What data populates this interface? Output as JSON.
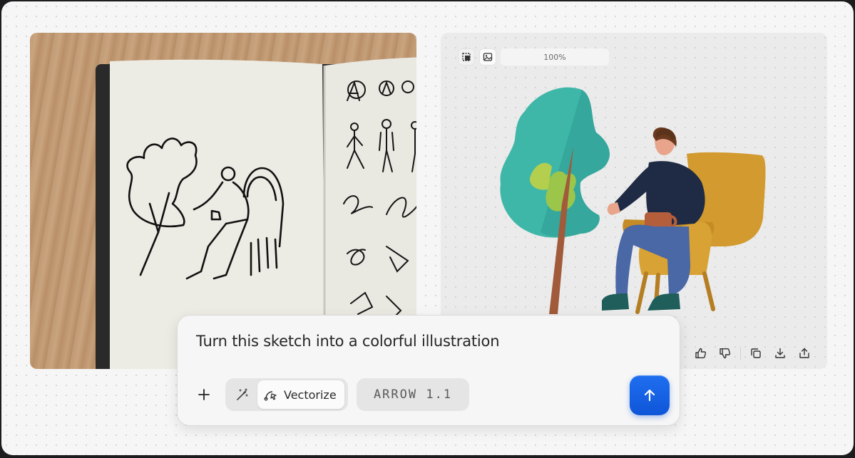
{
  "canvas": {
    "zoom_label": "100%",
    "toolbar": [
      {
        "icon": "crop-frame-icon"
      },
      {
        "icon": "image-icon"
      }
    ]
  },
  "input_image": {
    "description_icon": "sketchbook-photo"
  },
  "output_actions": [
    {
      "icon": "thumbs-up-icon"
    },
    {
      "icon": "thumbs-down-icon"
    },
    {
      "icon": "copy-icon"
    },
    {
      "icon": "download-icon"
    },
    {
      "icon": "share-icon"
    }
  ],
  "prompt": {
    "text": "Turn this sketch into a colorful illustration",
    "add_icon": "plus-icon",
    "magic_icon": "magic-wand-icon",
    "mode_label": "Vectorize",
    "mode_icon": "pen-curve-icon",
    "model_label": "ARROW 1.1",
    "send_icon": "arrow-up-icon"
  },
  "colors": {
    "accent": "#1463e6",
    "tree_teal": "#3fb7a8",
    "tree_lime": "#9cc64a",
    "trunk": "#a15a3a",
    "chair": "#d29a2f",
    "sweater": "#1f2a44",
    "pants": "#4a67a6",
    "shoes": "#1f5e5a"
  }
}
